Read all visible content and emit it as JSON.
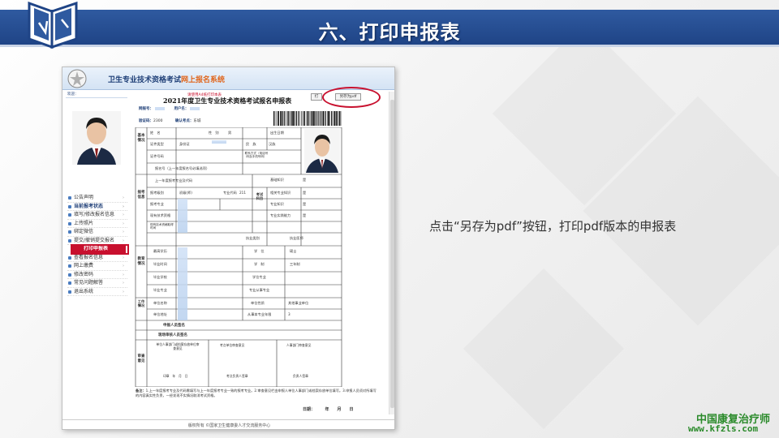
{
  "slide": {
    "title": "六、打印申报表",
    "caption": "点击“另存为pdf”按钮，打印pdf版本的申报表"
  },
  "system": {
    "title_part1": "卫生专业技术资格考试",
    "title_part2": "网上报名系统",
    "welcome": "欢迎："
  },
  "sidebar": {
    "items": [
      {
        "label": "公告声明"
      },
      {
        "label": "当前报考状态"
      },
      {
        "label": "填写/修改报名信息"
      },
      {
        "label": "上传照片"
      },
      {
        "label": "绑定微信"
      },
      {
        "label": "提交/撤销提交报名"
      },
      {
        "label": "打印申报表"
      },
      {
        "label": "查看报名信息"
      },
      {
        "label": "网上缴费"
      },
      {
        "label": "修改密码"
      },
      {
        "label": "常见问题解答"
      },
      {
        "label": "退出系统"
      }
    ]
  },
  "form": {
    "page_hint": "请使用A4纸打印本表",
    "title": "2021年度卫生专业技术资格考试报名申报表",
    "print_button": "打",
    "pdf_button": "另存为pdf",
    "net_no_label": "网报号：",
    "user_label": "用户名：",
    "verify_label": "验证码：",
    "verify_value": "2300",
    "confirm_label": "确认考点：",
    "confirm_value": "东城",
    "rows": [
      {
        "label": "基本情况"
      },
      {
        "label": "姓　名"
      },
      {
        "label": "性　别",
        "value": "男"
      },
      {
        "label": "出生日期"
      },
      {
        "label": "证件类型",
        "value": "身份证"
      },
      {
        "label": "民　族",
        "value": "汉族"
      },
      {
        "label": "证件号码"
      },
      {
        "label": "联系方式（电话号码及手机号码）"
      },
      {
        "label": "报名号（上一年度报名号必填选项）"
      },
      {
        "label": "上一年度报考专业及代码"
      },
      {
        "label": "报考信息"
      },
      {
        "label": "报考级别",
        "value": "初级(师)"
      },
      {
        "label": "专业代码",
        "value": "211"
      },
      {
        "label": "报考专业"
      },
      {
        "label": "现有技术资格"
      },
      {
        "label": "现有技术资格取得时间"
      },
      {
        "label": "基础知识",
        "value": "是"
      },
      {
        "label": "相关专业知识",
        "value": "是"
      },
      {
        "label": "专业知识",
        "value": "是"
      },
      {
        "label": "专业实践能力",
        "value": "是"
      },
      {
        "label": "考试科目"
      },
      {
        "label": "执业类别",
        "value": "执业医师"
      },
      {
        "label": "教育情况"
      },
      {
        "label": "最高学历"
      },
      {
        "label": "毕业时间"
      },
      {
        "label": "毕业学校"
      },
      {
        "label": "毕业专业"
      },
      {
        "label": "学　位",
        "value": "硕士"
      },
      {
        "label": "学　制",
        "value": "三年制"
      },
      {
        "label": "学位专业"
      },
      {
        "label": "专业从事专业"
      },
      {
        "label": "工作情况"
      },
      {
        "label": "单位名称"
      },
      {
        "label": "单位地址"
      },
      {
        "label": "单位性质",
        "value": "其他事业单位"
      },
      {
        "label": "从事本专业年限",
        "value": "3"
      },
      {
        "label": "申报人员签名"
      },
      {
        "label": "现场审核人员签名"
      },
      {
        "label": "审查意见"
      },
      {
        "label": "单位人事部门或档案存放单位审查意见"
      },
      {
        "label": "考点单位审查意见"
      },
      {
        "label": "人事部门审查意见"
      },
      {
        "label": "印章　年　月　日"
      },
      {
        "label": "考点负责人签章"
      },
      {
        "label": "负责人签章"
      }
    ],
    "note_label": "备注：",
    "note_text": "1.上一年度报考专业及代码需填写与上一年度报考专业一致的报考专业。2.审查意见栏由申报人单位人事部门或档案存放单位填写。3.申报人员须对所填写的内容真实性负责，一经发现不实情况取消考试资格。",
    "sign_date": "日期：　　　年　　月　　日"
  },
  "footer": {
    "copyright": "版权所有 ©国家卫生健康委人才交流服务中心"
  },
  "watermark": {
    "line1": "中国康复治疗师",
    "line2": "www.kfzls.com"
  }
}
